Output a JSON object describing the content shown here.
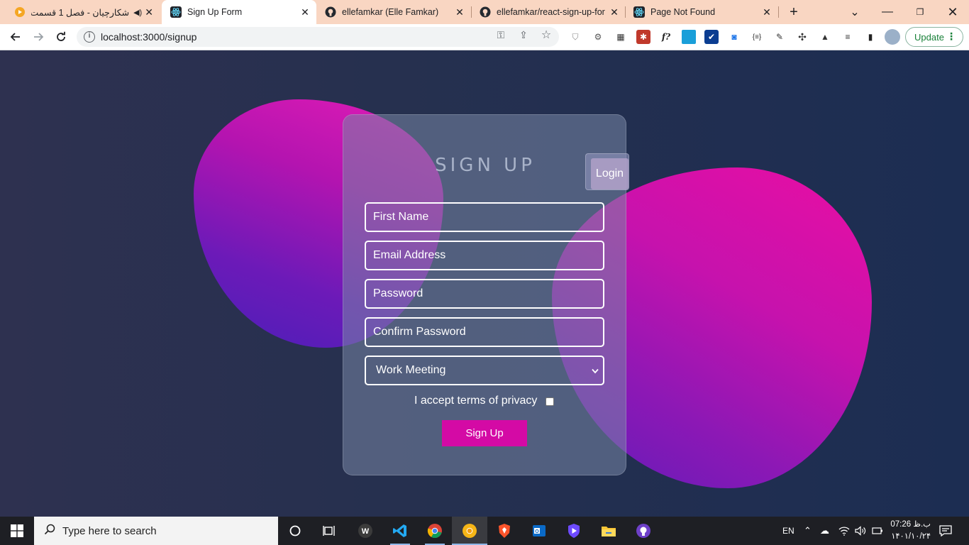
{
  "tabs": [
    {
      "title": "شکارچیان - فصل 1 قسمت",
      "favicon": "play-icon",
      "muted_icon": "speaker-icon"
    },
    {
      "title": "Sign Up Form",
      "favicon": "react-icon",
      "active": true
    },
    {
      "title": "ellefamkar (Elle Famkar)",
      "favicon": "github-icon"
    },
    {
      "title": "ellefamkar/react-sign-up-for",
      "favicon": "github-icon"
    },
    {
      "title": "Page Not Found",
      "favicon": "react-icon"
    }
  ],
  "address_bar": {
    "url": "localhost:3000/signup"
  },
  "update_label": "Update",
  "signup": {
    "title": "SIGN UP",
    "login_label": "Login",
    "first_name": "First Name",
    "email": "Email Address",
    "password": "Password",
    "confirm_password": "Confirm Password",
    "meeting_selected": "Work Meeting",
    "terms_label": "I accept terms of privacy",
    "terms_checked": false,
    "submit_label": "Sign Up"
  },
  "colors": {
    "accent": "#d40aa5",
    "blob_pink": "#e21cb5",
    "blob_purple": "#5f1cb9",
    "background": "#1f2b4f"
  },
  "taskbar": {
    "search_placeholder": "Type here to search",
    "language": "EN",
    "time": "07:26 ب.ظ",
    "date": "۱۴۰۱/۱۰/۲۴"
  }
}
